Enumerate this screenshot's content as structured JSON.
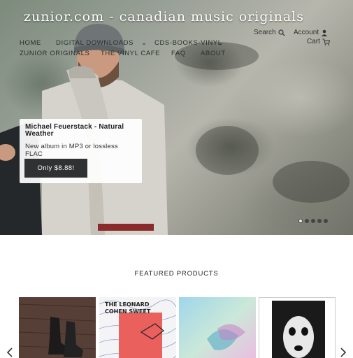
{
  "header": {
    "site_title": "zunior.com - canadian music originals",
    "search_label": "Search",
    "account_label": "Account",
    "cart_label": "Cart"
  },
  "nav": {
    "row1": [
      "Home",
      "Digital Downloads",
      "CDs-Books-Vinyl"
    ],
    "row2": [
      "Zunior Originals",
      "The Vinyl Cafe",
      "FAQ",
      "About"
    ]
  },
  "slideshow": {
    "title": "Michael Feuerstack - Natural Weather",
    "subtitle": "New album in MP3 or lossless FLAC",
    "button_label": "Only $8.88!",
    "slide_count": 5,
    "active_slide": 1
  },
  "featured": {
    "heading": "Featured Products",
    "products": [
      {
        "name": "boots-album-cover",
        "cover_text": ""
      },
      {
        "name": "leonard-cohen-sweet-cover",
        "cover_text": "THE LEONARD COHEN SWEET"
      },
      {
        "name": "pastel-album-cover",
        "cover_text": ""
      },
      {
        "name": "mask-book-cover",
        "cover_text": ""
      }
    ]
  },
  "colors": {
    "button_bg": "#2f3132",
    "text_dark": "#222222",
    "hero_overlay_card": "#ffffff"
  }
}
